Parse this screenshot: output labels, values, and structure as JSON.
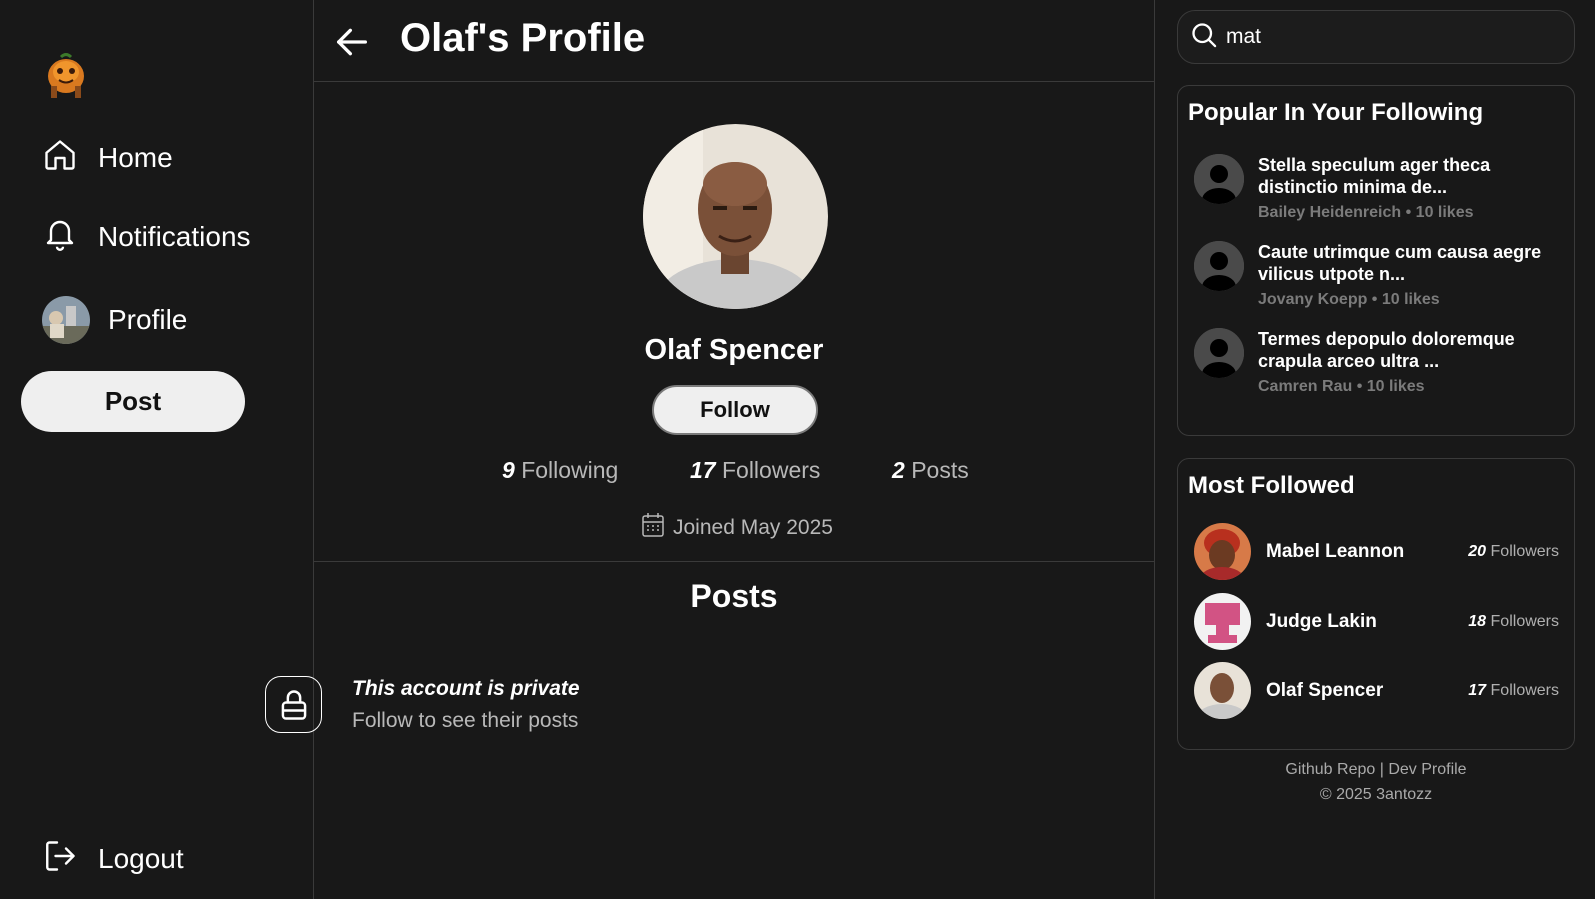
{
  "nav": {
    "home": "Home",
    "notifications": "Notifications",
    "profile": "Profile",
    "post": "Post",
    "logout": "Logout"
  },
  "header": {
    "title": "Olaf's Profile"
  },
  "profile": {
    "name": "Olaf Spencer",
    "follow_label": "Follow",
    "following_count": "9",
    "following_label": "Following",
    "followers_count": "17",
    "followers_label": "Followers",
    "posts_count": "2",
    "posts_label": "Posts",
    "joined": "Joined May 2025"
  },
  "posts": {
    "title": "Posts",
    "private_title": "This account is private",
    "private_sub": "Follow to see their posts"
  },
  "search": {
    "value": "mat"
  },
  "popular": {
    "title": "Popular In Your Following",
    "items": [
      {
        "title": "Stella speculum ager theca distinctio minima de...",
        "meta": "Bailey Heidenreich • 10 likes"
      },
      {
        "title": "Caute utrimque cum causa aegre vilicus utpote n...",
        "meta": "Jovany Koepp • 10 likes"
      },
      {
        "title": "Termes depopulo doloremque crapula arceo ultra ...",
        "meta": "Camren Rau • 10 likes"
      }
    ]
  },
  "most_followed": {
    "title": "Most Followed",
    "items": [
      {
        "name": "Mabel Leannon",
        "count": "20",
        "label": "Followers"
      },
      {
        "name": "Judge Lakin",
        "count": "18",
        "label": "Followers"
      },
      {
        "name": "Olaf Spencer",
        "count": "17",
        "label": "Followers"
      }
    ]
  },
  "footer": {
    "github": "Github Repo",
    "separator": "|",
    "dev": "Dev Profile",
    "copyright": "© 2025 3antozz"
  },
  "colors": {
    "background": "#181818",
    "border": "#3a3a3a",
    "button_bg": "#efefef",
    "muted_text": "#b8b8b8"
  }
}
